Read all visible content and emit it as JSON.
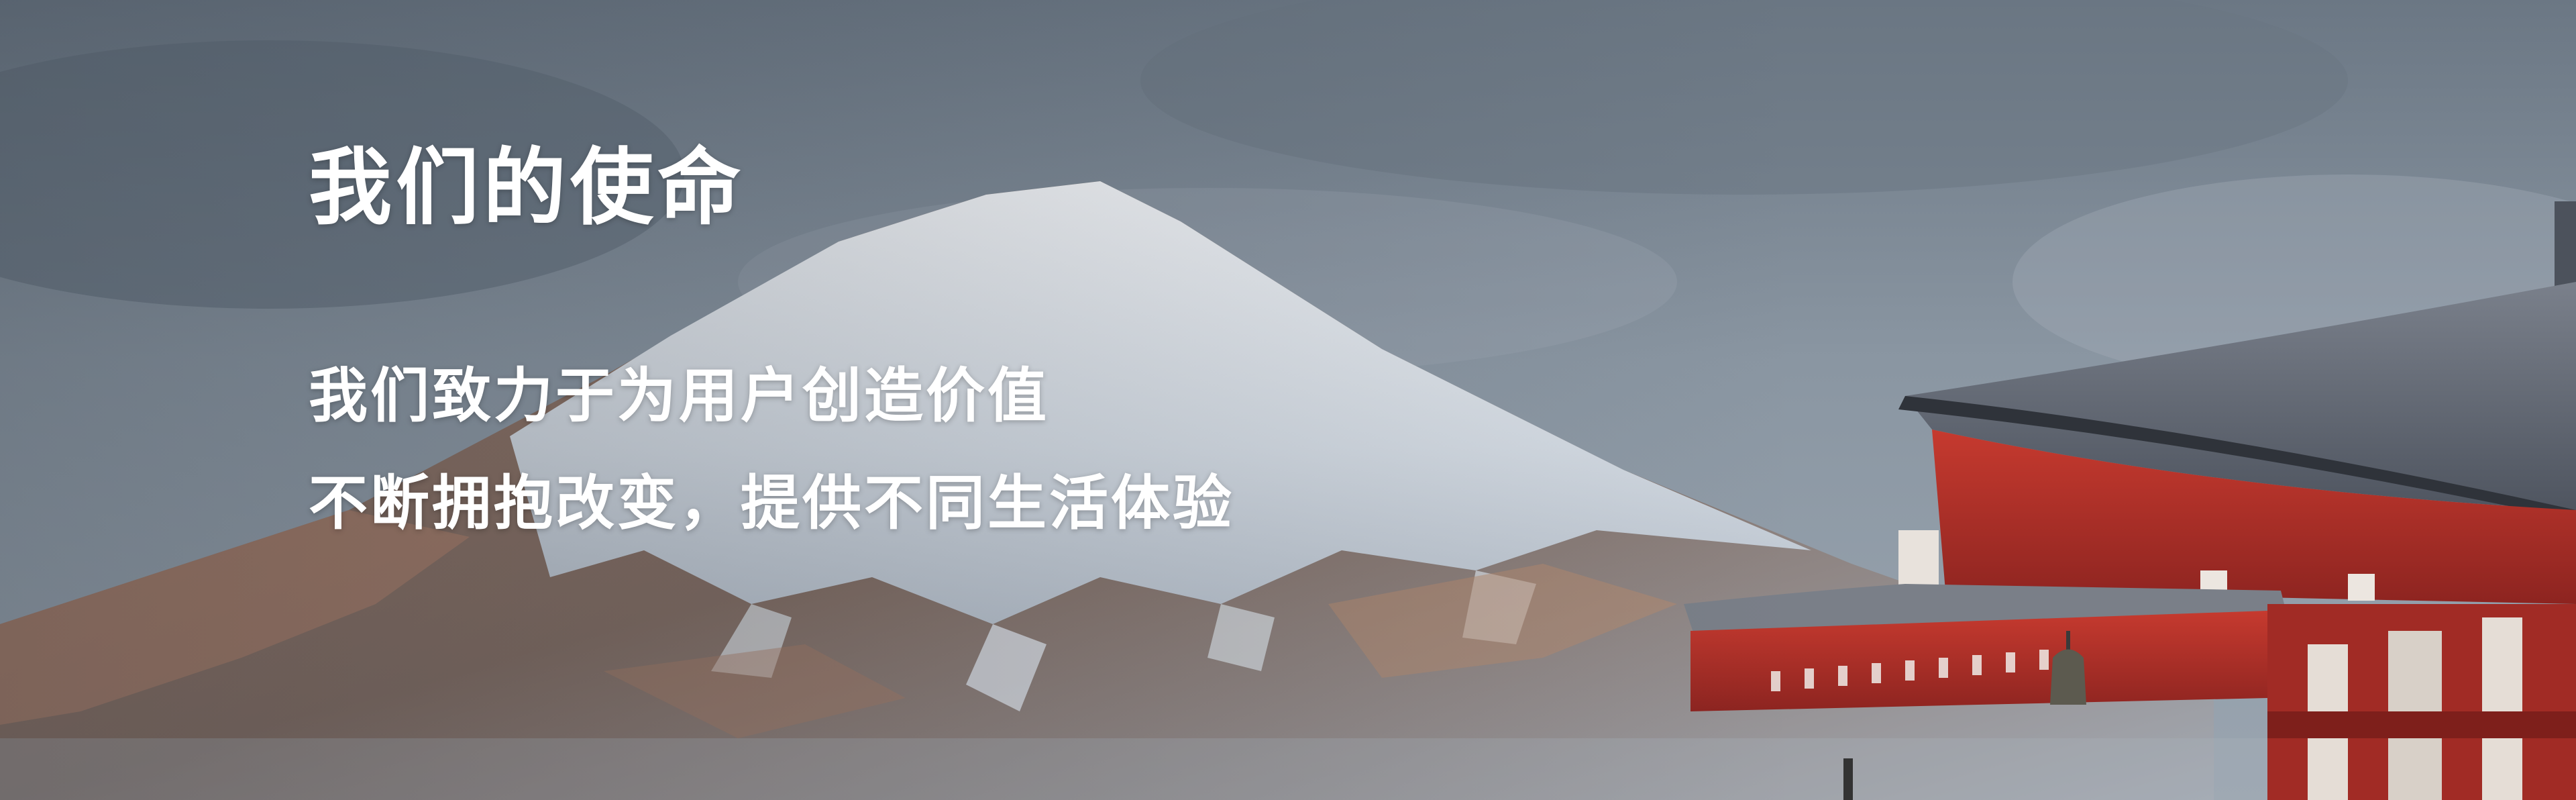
{
  "banner": {
    "heading": "我们的使命",
    "tagline": [
      "我们致力于为用户创造价值",
      "不断拥抱改变，提供不同生活体验"
    ]
  },
  "background": {
    "scene": [
      "snow-capped-mountain",
      "red-pagoda-roof",
      "overcast-sky"
    ],
    "colors": {
      "sky": "#7d8a96",
      "snow": "#e6ebf0",
      "rock": "#8a6d5c",
      "pagoda_red": "#b8302a",
      "roof_gray": "#5d6470"
    }
  }
}
